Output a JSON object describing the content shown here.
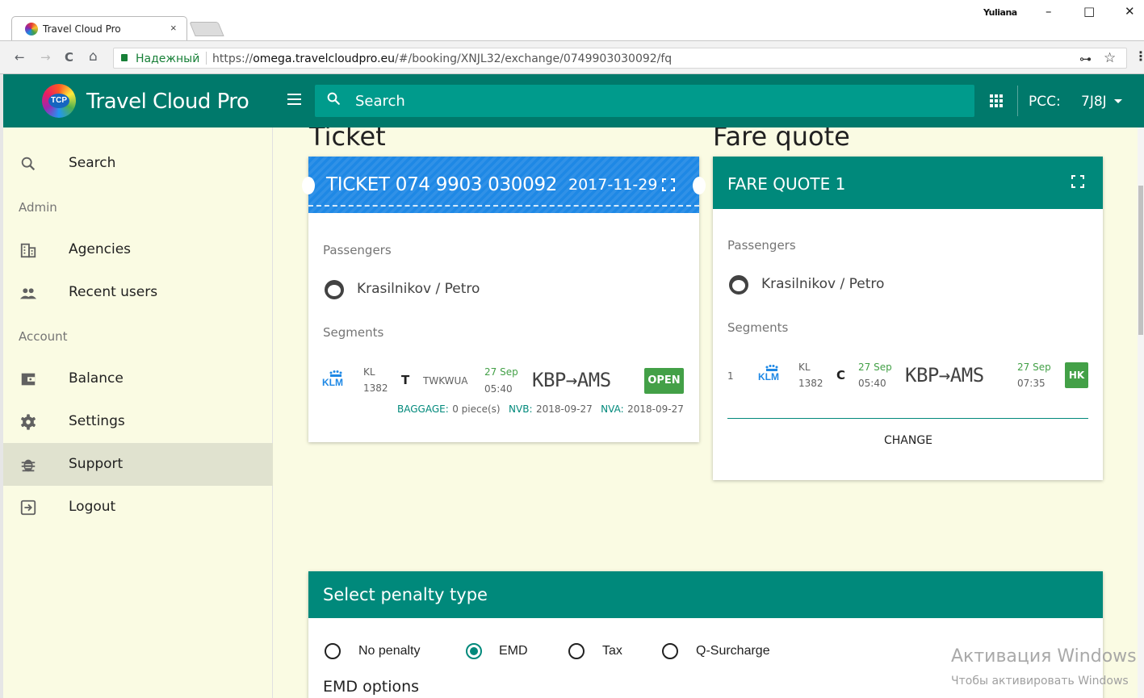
{
  "browser": {
    "tab_title": "Travel Cloud Pro",
    "tab_close": "×",
    "user": "Yuliana",
    "minimize": "–",
    "maximize": "□",
    "close": "✕",
    "back": "←",
    "forward": "→",
    "reload": "C",
    "home": "⌂",
    "secure_label": "Надежный",
    "url_prefix": "https://",
    "url_domain": "omega.travelcloudpro.eu",
    "url_path": "/#/booking/XNJL32/exchange/0749903030092/fq",
    "key": "⊶",
    "star": "☆",
    "menu": "⋮"
  },
  "header": {
    "logo_text": "TCP",
    "app_title": "Travel Cloud Pro",
    "search_placeholder": "Search",
    "pcc_label": "PCC:",
    "pcc_value": "7J8J"
  },
  "sidebar": {
    "search": "Search",
    "admin_section": "Admin",
    "agencies": "Agencies",
    "recent_users": "Recent users",
    "account_section": "Account",
    "balance": "Balance",
    "settings": "Settings",
    "support": "Support",
    "logout": "Logout",
    "active_item": "Support"
  },
  "ticket": {
    "heading": "Ticket",
    "title": "TICKET 074 9903 030092",
    "date": "2017-11-29",
    "passengers_label": "Passengers",
    "passenger": "Krasilnikov / Petro",
    "segments_label": "Segments",
    "segment": {
      "airline": "KL",
      "flight": "1382",
      "class": "T",
      "fare_basis": "TWKWUA",
      "date": "27 Sep",
      "time": "05:40",
      "route": "KBP→AMS",
      "status": "OPEN",
      "baggage_label": "BAGGAGE:",
      "baggage_value": "0 piece(s)",
      "nvb_label": "NVB:",
      "nvb_value": "2018-09-27",
      "nva_label": "NVA:",
      "nva_value": "2018-09-27"
    }
  },
  "fare_quote": {
    "heading": "Fare quote",
    "title": "FARE QUOTE 1",
    "passengers_label": "Passengers",
    "passenger": "Krasilnikov / Petro",
    "segments_label": "Segments",
    "segment": {
      "number": "1",
      "airline": "KL",
      "flight": "1382",
      "class": "C",
      "dep_date": "27 Sep",
      "dep_time": "05:40",
      "route": "KBP→AMS",
      "arr_date": "27 Sep",
      "arr_time": "07:35",
      "status": "HK"
    },
    "change_label": "CHANGE"
  },
  "penalty": {
    "title": "Select penalty type",
    "options": [
      "No penalty",
      "EMD",
      "Tax",
      "Q-Surcharge"
    ],
    "selected": "EMD",
    "emd_options_label": "EMD options"
  },
  "watermark": {
    "line1": "Активация Windows",
    "line2": "Чтобы активировать Windows"
  },
  "colors": {
    "teal": "#00796b",
    "teal_card": "#00897b",
    "ticket_blue": "#1e88e5",
    "status_green": "#43a047",
    "background": "#fafbe3"
  }
}
